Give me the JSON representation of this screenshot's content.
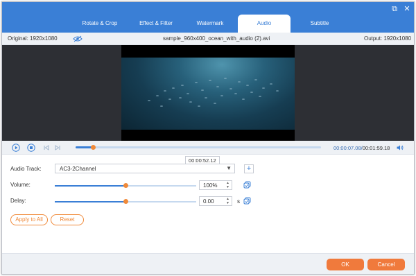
{
  "window": {
    "restore_glyph": "⧉",
    "close_glyph": "✕"
  },
  "tabs": [
    {
      "label": "Rotate & Crop"
    },
    {
      "label": "Effect & Filter"
    },
    {
      "label": "Watermark"
    },
    {
      "label": "Audio",
      "active": true
    },
    {
      "label": "Subtitle"
    }
  ],
  "info": {
    "original": "Original: 1920x1080",
    "filename": "sample_960x400_ocean_with_audio (2).avi",
    "output": "Output: 1920x1080"
  },
  "player": {
    "progress_fraction": 0.07,
    "current_time": "00:00:07.08",
    "separator": "/",
    "total_time": "00:01:59.18"
  },
  "audio": {
    "track_label": "Audio Track:",
    "track_value": "AC3-2Channel",
    "track_tooltip": "00:00:52.12",
    "volume_label": "Volume:",
    "volume_value": "100%",
    "volume_fraction": 0.5,
    "delay_label": "Delay:",
    "delay_value": "0.00",
    "delay_unit": "s",
    "delay_fraction": 0.5
  },
  "buttons": {
    "apply_all": "Apply to All",
    "reset": "Reset",
    "ok": "OK",
    "cancel": "Cancel"
  },
  "colors": {
    "accent_blue": "#3a7fd6",
    "accent_orange": "#f08a3a"
  }
}
